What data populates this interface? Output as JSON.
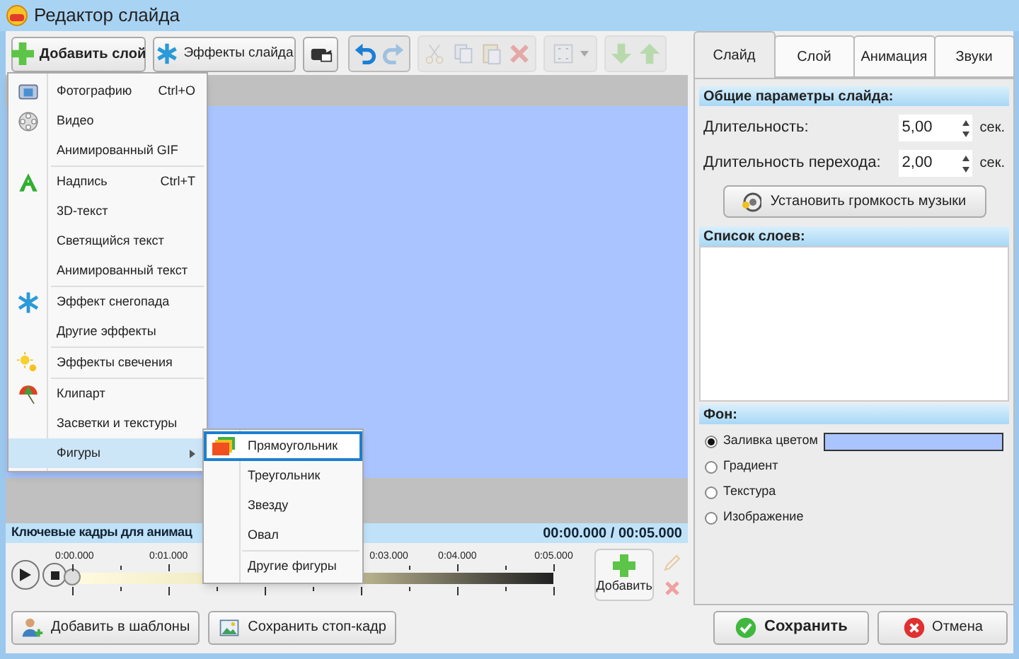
{
  "window": {
    "title": "Редактор слайда"
  },
  "toolbar": {
    "buttons": [
      {
        "kind": "add",
        "label": "Добавить слой",
        "disabled": false
      },
      {
        "kind": "effects",
        "label": "Эффекты слайда",
        "disabled": false
      },
      {
        "kind": "camera",
        "disabled": false
      },
      {
        "kind": "undo",
        "disabled": false
      },
      {
        "kind": "redo",
        "disabled": true
      },
      {
        "kind": "cut",
        "disabled": true
      },
      {
        "kind": "copy",
        "disabled": true
      },
      {
        "kind": "paste",
        "disabled": true
      },
      {
        "kind": "delete",
        "disabled": true
      },
      {
        "kind": "fit",
        "disabled": true
      },
      {
        "kind": "down",
        "disabled": true
      },
      {
        "kind": "up",
        "disabled": true
      }
    ]
  },
  "menu": {
    "groups": [
      [
        {
          "label": "Фотографию",
          "shortcut": "Ctrl+O",
          "selected": false
        },
        {
          "label": "Видео",
          "selected": false
        },
        {
          "label": "Анимированный GIF",
          "selected": false
        }
      ],
      [
        {
          "label": "Надпись",
          "shortcut": "Ctrl+T",
          "selected": false
        },
        {
          "label": "3D-текст",
          "selected": false
        },
        {
          "label": "Светящийся текст",
          "selected": false
        },
        {
          "label": "Анимированный текст",
          "selected": false
        }
      ],
      [
        {
          "label": "Эффект снегопада",
          "selected": false
        },
        {
          "label": "Другие эффекты",
          "selected": false
        }
      ],
      [
        {
          "label": "Эффекты свечения",
          "selected": false
        }
      ],
      [
        {
          "label": "Клипарт",
          "selected": false
        },
        {
          "label": "Засветки и текстуры",
          "selected": false
        },
        {
          "label": "Фигуры",
          "selected": true,
          "submenu": true
        }
      ]
    ]
  },
  "submenu": {
    "groups": [
      [
        {
          "label": "Прямоугольник",
          "selected": true
        },
        {
          "label": "Треугольник",
          "selected": false
        },
        {
          "label": "Звезду",
          "selected": false
        },
        {
          "label": "Овал",
          "selected": false
        }
      ],
      [
        {
          "label": "Другие фигуры",
          "selected": false
        }
      ]
    ]
  },
  "timeline": {
    "title": "Ключевые кадры для анимац",
    "time": "00:00.000 / 00:05.000",
    "ticks": [
      "0:00.000",
      "0:01.000",
      "0:03.000",
      "0:04.000",
      "0:05.000"
    ],
    "playhead": {
      "level": 0
    },
    "add_label": "Добавить"
  },
  "tabs": [
    {
      "label": "Слайд",
      "selected": true
    },
    {
      "label": "Слой",
      "selected": false
    },
    {
      "label": "Анимация",
      "selected": false
    },
    {
      "label": "Звуки",
      "selected": false
    }
  ],
  "slide_params": {
    "header": "Общие параметры слайда:",
    "fields": [
      {
        "label": "Длительность:",
        "value": "5,00",
        "unit": "сек."
      },
      {
        "label": "Длительность перехода:",
        "value": "2,00",
        "unit": "сек."
      }
    ],
    "button": "Установить громкость музыки"
  },
  "layers": {
    "header": "Список слоев:"
  },
  "background": {
    "header": "Фон:",
    "options": [
      {
        "label": "Заливка цветом",
        "selected": true
      },
      {
        "label": "Градиент",
        "selected": false
      },
      {
        "label": "Текстура",
        "selected": false
      },
      {
        "label": "Изображение",
        "selected": false
      }
    ]
  },
  "bottom_buttons": [
    {
      "kind": "templates",
      "label": "Добавить в шаблоны"
    },
    {
      "kind": "snapshot",
      "label": "Сохранить стоп-кадр"
    },
    {
      "kind": "save",
      "label": "Сохранить"
    },
    {
      "kind": "cancel",
      "label": "Отмена"
    }
  ]
}
